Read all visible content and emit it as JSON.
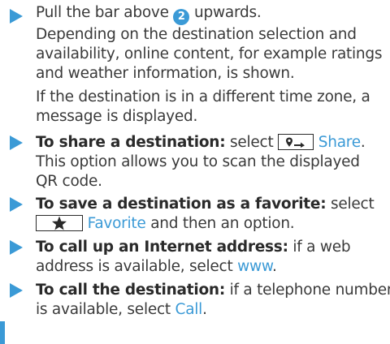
{
  "steps": [
    {
      "lines": [
        {
          "a": "Pull the bar above ",
          "badge": "2",
          "b": " upwards."
        },
        "Depending on the destination selection and",
        "availability, online content, for example ratings",
        "and weather information, is shown."
      ],
      "note": [
        "If the destination is in a different time zone, a",
        "message is displayed."
      ]
    },
    {
      "bold": "To share a destination:",
      "after_bold": " select ",
      "link": "Share",
      "end": ".",
      "lines": [
        "This option allows you to scan the displayed",
        "QR code."
      ]
    },
    {
      "bold": "To save a destination as a favorite:",
      "after_bold": " select",
      "link": "Favorite",
      "end": " and then an option."
    },
    {
      "bold": "To call up an Internet address:",
      "after_bold": " if a web",
      "line2_pre": "address is available, select ",
      "link": "www",
      "end": "."
    },
    {
      "bold": "To call the destination:",
      "after_bold": " if a telephone number",
      "line2_pre": "is available, select ",
      "link": "Call",
      "end": "."
    }
  ],
  "icons": {
    "share": "share-destination-icon",
    "favorite": "star-icon",
    "bullet": "triangle-arrow-icon"
  },
  "colors": {
    "accent": "#3b9ad6",
    "text": "#3a3a3a"
  }
}
